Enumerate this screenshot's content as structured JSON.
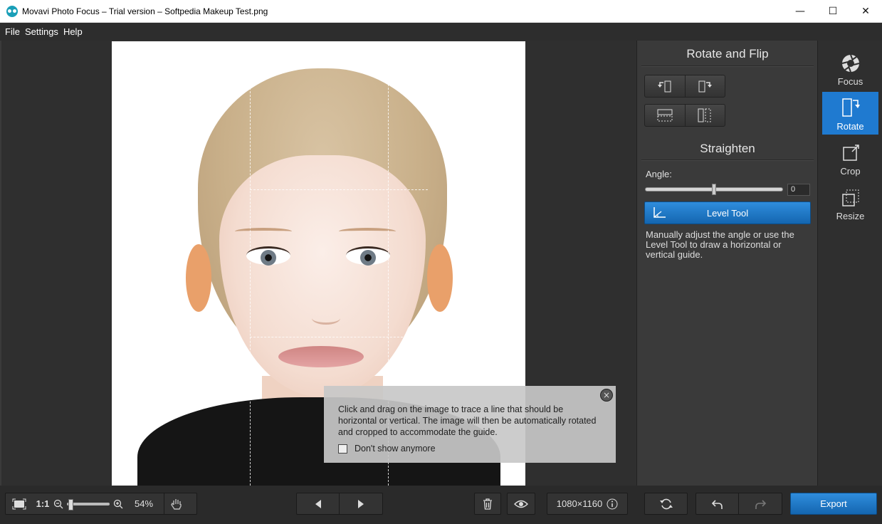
{
  "window": {
    "title": "Movavi Photo Focus – Trial version – Softpedia Makeup Test.png",
    "minimize": "—",
    "maximize": "☐",
    "close": "✕"
  },
  "menu": [
    "File",
    "Settings",
    "Help"
  ],
  "panel": {
    "rotate_title": "Rotate and Flip",
    "straighten_title": "Straighten",
    "angle_label": "Angle:",
    "angle_value": "0",
    "angle_level": 0.5,
    "level_tool_label": "Level Tool",
    "description": "Manually adjust the angle or use the Level Tool to draw a horizontal or vertical guide."
  },
  "tools": [
    {
      "label": "Focus",
      "icon": "aperture-icon",
      "active": false
    },
    {
      "label": "Rotate",
      "icon": "rotate-icon",
      "active": true
    },
    {
      "label": "Crop",
      "icon": "crop-icon",
      "active": false
    },
    {
      "label": "Resize",
      "icon": "resize-icon",
      "active": false
    }
  ],
  "hint": {
    "text": "Click and drag on the image to trace a line that should be horizontal or vertical. The image will then be automatically rotated and cropped to accommodate the guide.",
    "checkbox_label": "Don't show anymore",
    "checked": false
  },
  "bottom": {
    "actual_size": "1:1",
    "zoom": "54%",
    "dimensions": "1080×1160",
    "export_label": "Export"
  },
  "colors": {
    "accent": "#1f7ad0",
    "panel": "#3a3a3a",
    "dark": "#2b2b2b"
  }
}
